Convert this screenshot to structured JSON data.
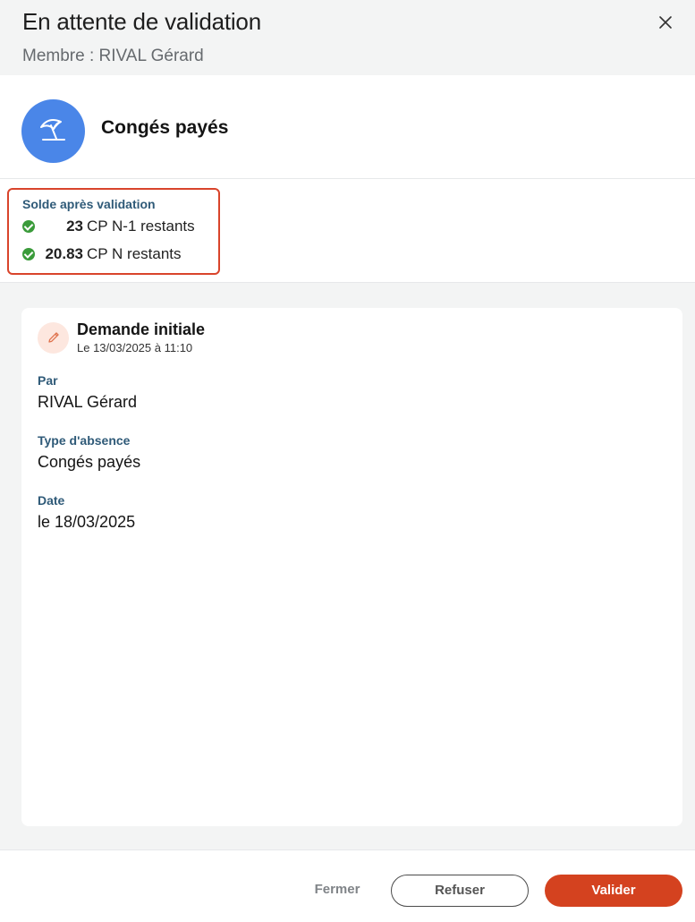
{
  "header": {
    "title": "En attente de validation",
    "subtitle": "Membre : RIVAL Gérard",
    "close_icon": "close-icon"
  },
  "leave": {
    "type_name": "Congés payés",
    "icon": "beach-umbrella-icon",
    "icon_color": "#4a86e8"
  },
  "balance": {
    "label": "Solde après validation",
    "highlight_color": "#d9442b",
    "rows": [
      {
        "value": "23",
        "text": "CP N-1 restants",
        "status_icon": "check-circle-icon"
      },
      {
        "value": "20.83",
        "text": "CP N restants",
        "status_icon": "check-circle-icon"
      }
    ]
  },
  "request": {
    "icon": "pencil-icon",
    "title": "Demande initiale",
    "date": "Le 13/03/2025 à 11:10",
    "fields": [
      {
        "label": "Par",
        "value": "RIVAL Gérard"
      },
      {
        "label": "Type d'absence",
        "value": "Congés payés"
      },
      {
        "label": "Date",
        "value": "le 18/03/2025"
      }
    ]
  },
  "footer": {
    "close_label": "Fermer",
    "refuse_label": "Refuser",
    "validate_label": "Valider",
    "accent_color": "#d4421f"
  }
}
